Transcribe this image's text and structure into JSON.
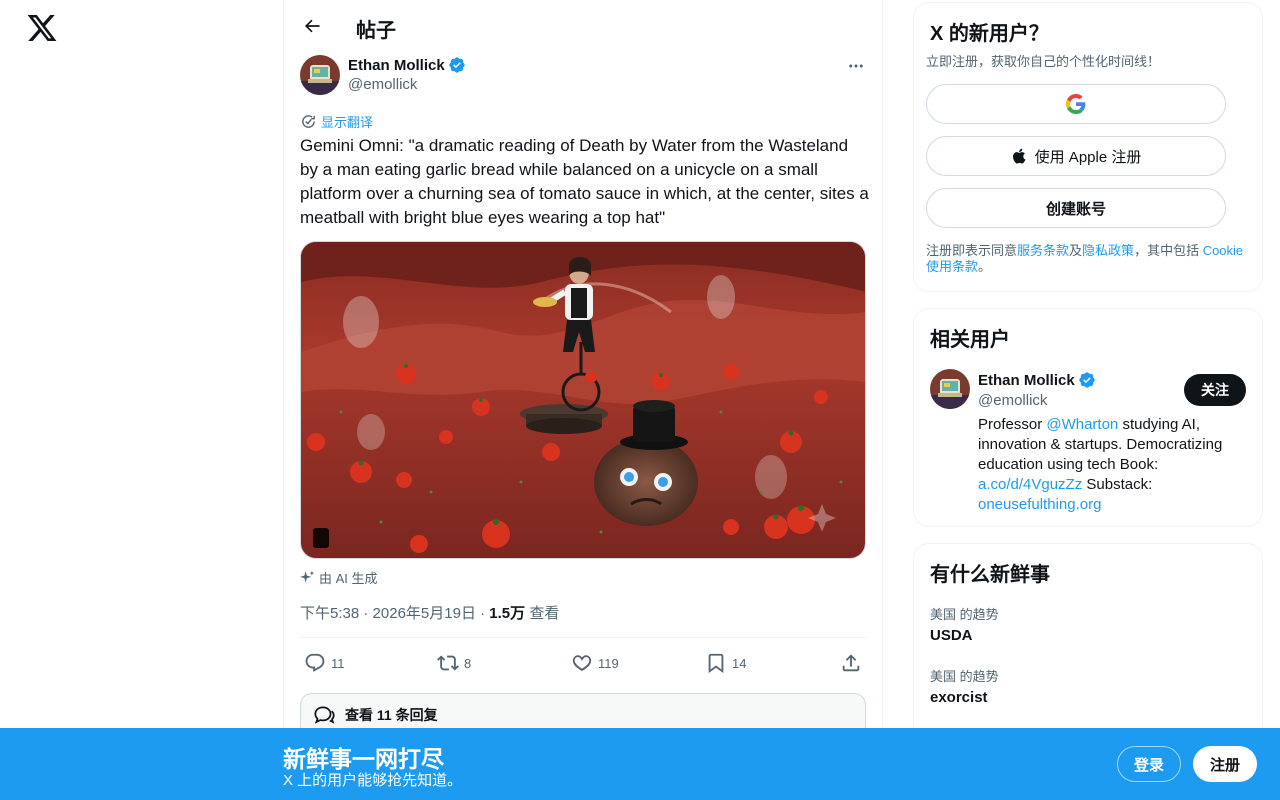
{
  "header": {
    "title": "帖子"
  },
  "post": {
    "author_name": "Ethan Mollick",
    "author_handle": "@emollick",
    "translate_label": "显示翻译",
    "text": "Gemini Omni: \"a dramatic reading of Death by Water from the Wasteland by a man eating garlic bread while balanced on a unicycle on a small platform over a churning sea of tomato sauce in which, at the center, sites a meatball with bright blue eyes wearing a top hat\"",
    "ai_label": "由 AI 生成",
    "time": "下午5:38",
    "date": "2026年5月19日",
    "views_count": "1.5万",
    "views_label": "查看",
    "stats": {
      "replies": "11",
      "reposts": "8",
      "likes": "119",
      "bookmarks": "14"
    },
    "view_replies_label": "查看 11 条回复"
  },
  "signup_card": {
    "title": "X 的新用户？",
    "subtitle": "立即注册，获取你自己的个性化时间线！",
    "apple_label": "使用 Apple 注册",
    "create_label": "创建账号",
    "terms_prefix": "注册即表示同意",
    "terms_link": "服务条款",
    "terms_and": "及",
    "privacy_link": "隐私政策",
    "terms_mid": "，其中包括 ",
    "cookie_link": "Cookie 使用条款",
    "terms_end": "。"
  },
  "related": {
    "title": "相关用户",
    "name": "Ethan Mollick",
    "handle": "@emollick",
    "follow_label": "关注",
    "bio_1": "Professor ",
    "bio_link_1": "@Wharton",
    "bio_2": " studying AI, innovation & startups. Democratizing education using tech Book: ",
    "bio_link_2": "a.co/d/4VguzZz",
    "bio_3": " Substack: ",
    "bio_link_3": "oneusefulthing.org"
  },
  "trends": {
    "title": "有什么新鲜事",
    "items": [
      {
        "context": "美国 的趋势",
        "name": "USDA"
      },
      {
        "context": "美国 的趋势",
        "name": "exorcist"
      }
    ]
  },
  "banner": {
    "title": "新鲜事一网打尽",
    "subtitle": "X 上的用户能够抢先知道。",
    "login_label": "登录",
    "signup_label": "注册"
  },
  "colors": {
    "accent": "#1d9bf0",
    "text": "#0f1419",
    "muted": "#536471",
    "border": "#eff3f4",
    "verified": "#1d9bf0"
  }
}
